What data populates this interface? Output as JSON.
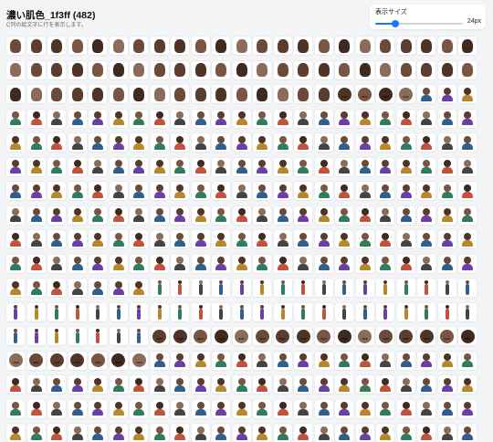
{
  "header": {
    "title": "濃い肌色_1f3ff (482)",
    "subtitle": "C列の絵文字に行を表示します。"
  },
  "size_control": {
    "label": "表示サイズ",
    "value": 24,
    "min": 12,
    "max": 64,
    "value_text": "24px"
  },
  "grid": {
    "tile_count": 391,
    "kinds": [
      "hand",
      "hand",
      "hand",
      "hand",
      "hand",
      "hand",
      "hand",
      "hand",
      "hand",
      "hand",
      "hand",
      "hand",
      "hand",
      "hand",
      "hand",
      "hand",
      "hand",
      "hand",
      "hand",
      "hand",
      "hand",
      "hand",
      "hand",
      "hand",
      "hand",
      "hand",
      "hand",
      "hand",
      "hand",
      "hand",
      "hand",
      "hand",
      "hand",
      "hand",
      "hand",
      "hand",
      "hand",
      "hand",
      "hand",
      "hand",
      "hand",
      "hand",
      "hand",
      "hand",
      "hand",
      "hand",
      "hand",
      "hand",
      "hand",
      "hand",
      "hand",
      "hand",
      "hand",
      "hand",
      "hand",
      "hand",
      "hand",
      "hand",
      "hand",
      "hand",
      "hand",
      "hand",
      "face",
      "face",
      "face",
      "face",
      "person",
      "person",
      "person",
      "person",
      "person",
      "person",
      "person",
      "person",
      "person",
      "person",
      "person",
      "person",
      "person",
      "person",
      "person",
      "person",
      "person",
      "person",
      "person",
      "person",
      "person",
      "person",
      "person",
      "person",
      "person",
      "person",
      "person",
      "person",
      "person",
      "person",
      "person",
      "person",
      "person",
      "person",
      "person",
      "person",
      "person",
      "person",
      "person",
      "person",
      "person",
      "person",
      "person",
      "person",
      "person",
      "person",
      "person",
      "person",
      "person",
      "person",
      "person",
      "person",
      "person",
      "person",
      "person",
      "person",
      "person",
      "person",
      "person",
      "person",
      "person",
      "person",
      "person",
      "person",
      "person",
      "person",
      "person",
      "person",
      "person",
      "person",
      "person",
      "person",
      "person",
      "person",
      "person",
      "person",
      "person",
      "person",
      "person",
      "person",
      "person",
      "person",
      "person",
      "person",
      "person",
      "person",
      "person",
      "person",
      "person",
      "person",
      "person",
      "person",
      "person",
      "person",
      "person",
      "person",
      "person",
      "person",
      "person",
      "person",
      "person",
      "person",
      "person",
      "person",
      "person",
      "person",
      "person",
      "person",
      "person",
      "person",
      "person",
      "person",
      "person",
      "person",
      "person",
      "person",
      "person",
      "person",
      "person",
      "person",
      "person",
      "person",
      "person",
      "person",
      "person",
      "person",
      "person",
      "person",
      "person",
      "person",
      "person",
      "person",
      "person",
      "person",
      "person",
      "person",
      "person",
      "person",
      "person",
      "person",
      "person",
      "person",
      "person",
      "person",
      "person",
      "person",
      "person",
      "person",
      "person",
      "person",
      "person",
      "person",
      "person",
      "person",
      "person",
      "person",
      "person",
      "person",
      "person",
      "person",
      "person",
      "person",
      "person",
      "person",
      "person",
      "person",
      "person",
      "person",
      "person",
      "person",
      "person",
      "walk",
      "walk",
      "walk",
      "walk",
      "walk",
      "walk",
      "walk",
      "walk",
      "walk",
      "walk",
      "walk",
      "walk",
      "walk",
      "walk",
      "walk",
      "walk",
      "walk",
      "walk",
      "walk",
      "walk",
      "walk",
      "walk",
      "walk",
      "walk",
      "walk",
      "walk",
      "walk",
      "walk",
      "walk",
      "walk",
      "walk",
      "walk",
      "walk",
      "walk",
      "walk",
      "walk",
      "walk",
      "walk",
      "walk",
      "walk",
      "walk",
      "walk",
      "walk",
      "walk",
      "walk",
      "walk",
      "face",
      "face",
      "face",
      "face",
      "face",
      "face",
      "face",
      "face",
      "face",
      "face",
      "face",
      "face",
      "face",
      "face",
      "face",
      "face",
      "face",
      "face",
      "face",
      "face",
      "face",
      "face",
      "face",
      "person",
      "person",
      "person",
      "person",
      "person",
      "person",
      "person",
      "person",
      "person",
      "person",
      "person",
      "person",
      "person",
      "person",
      "person",
      "person",
      "person",
      "person",
      "person",
      "person",
      "person",
      "person",
      "person",
      "person",
      "person",
      "person",
      "person",
      "person",
      "person",
      "person",
      "person",
      "person",
      "person",
      "person",
      "person",
      "person",
      "person",
      "person",
      "person",
      "person",
      "person",
      "person",
      "person",
      "person",
      "person",
      "person",
      "person",
      "person",
      "person",
      "person",
      "person",
      "person",
      "person",
      "person",
      "person",
      "person",
      "person",
      "person",
      "person",
      "person",
      "person",
      "person",
      "person",
      "person",
      "person",
      "person",
      "person",
      "person",
      "person"
    ],
    "palette": [
      "#6b4a3a",
      "#5a3d2e",
      "#4e3427",
      "#7a5544",
      "#3f2a20",
      "#8b6b5a",
      "#2f5f8f",
      "#6a3fa8",
      "#b8862b",
      "#2e7d5b",
      "#c2523b",
      "#444444"
    ]
  }
}
